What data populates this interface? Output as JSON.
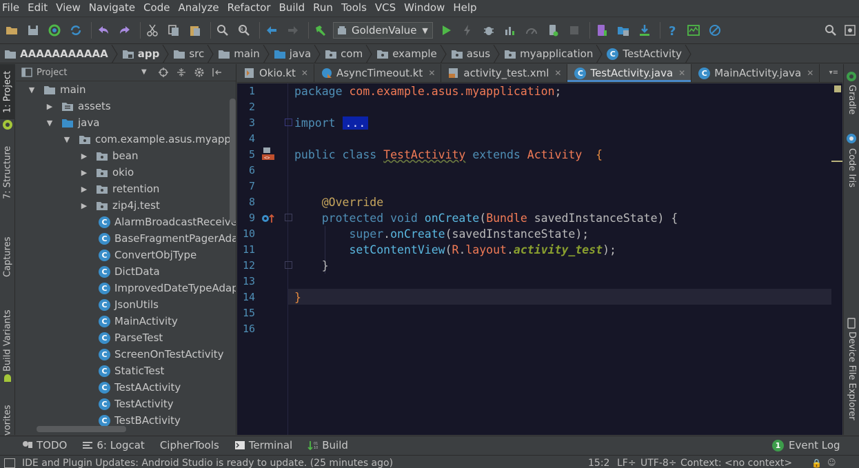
{
  "menu": [
    "File",
    "Edit",
    "View",
    "Navigate",
    "Code",
    "Analyze",
    "Refactor",
    "Build",
    "Run",
    "Tools",
    "VCS",
    "Window",
    "Help"
  ],
  "toolbar": {
    "run_config": "GoldenValue"
  },
  "breadcrumb": [
    "AAAAAAAAAAA",
    "app",
    "src",
    "main",
    "java",
    "com",
    "example",
    "asus",
    "myapplication",
    "TestActivity"
  ],
  "left_tabs": [
    "1: Project",
    "7: Structure",
    "Captures",
    "Build Variants",
    "vorites"
  ],
  "project_panel": {
    "title": "Project",
    "tree": [
      {
        "label": "main",
        "depth": 1,
        "state": "expanded",
        "kind": "folder"
      },
      {
        "label": "assets",
        "depth": 2,
        "state": "collapsed",
        "kind": "folder"
      },
      {
        "label": "java",
        "depth": 2,
        "state": "expanded",
        "kind": "folder-blue"
      },
      {
        "label": "com.example.asus.myapplicati",
        "depth": 3,
        "state": "expanded",
        "kind": "package"
      },
      {
        "label": "bean",
        "depth": 4,
        "state": "collapsed",
        "kind": "package"
      },
      {
        "label": "okio",
        "depth": 4,
        "state": "collapsed",
        "kind": "package"
      },
      {
        "label": "retention",
        "depth": 4,
        "state": "collapsed",
        "kind": "package"
      },
      {
        "label": "zip4j.test",
        "depth": 4,
        "state": "collapsed",
        "kind": "package"
      },
      {
        "label": "AlarmBroadcastReceiver",
        "depth": 4,
        "state": "leaf",
        "kind": "class"
      },
      {
        "label": "BaseFragmentPagerAdapte",
        "depth": 4,
        "state": "leaf",
        "kind": "class"
      },
      {
        "label": "ConvertObjType",
        "depth": 4,
        "state": "leaf",
        "kind": "class"
      },
      {
        "label": "DictData",
        "depth": 4,
        "state": "leaf",
        "kind": "class"
      },
      {
        "label": "ImprovedDateTypeAdapte",
        "depth": 4,
        "state": "leaf",
        "kind": "class"
      },
      {
        "label": "JsonUtils",
        "depth": 4,
        "state": "leaf",
        "kind": "class"
      },
      {
        "label": "MainActivity",
        "depth": 4,
        "state": "leaf",
        "kind": "class"
      },
      {
        "label": "ParseTest",
        "depth": 4,
        "state": "leaf",
        "kind": "class"
      },
      {
        "label": "ScreenOnTestActivity",
        "depth": 4,
        "state": "leaf",
        "kind": "class"
      },
      {
        "label": "StaticTest",
        "depth": 4,
        "state": "leaf",
        "kind": "class"
      },
      {
        "label": "TestAActivity",
        "depth": 4,
        "state": "leaf",
        "kind": "class"
      },
      {
        "label": "TestActivity",
        "depth": 4,
        "state": "leaf",
        "kind": "class"
      },
      {
        "label": "TestBActivity",
        "depth": 4,
        "state": "leaf",
        "kind": "class"
      }
    ]
  },
  "editor_tabs": [
    {
      "label": "Okio.kt",
      "active": false,
      "icon": "kotlin-file-icon"
    },
    {
      "label": "AsyncTimeout.kt",
      "active": false,
      "icon": "kotlin-class-icon"
    },
    {
      "label": "activity_test.xml",
      "active": false,
      "icon": "xml-file-icon"
    },
    {
      "label": "TestActivity.java",
      "active": true,
      "icon": "java-class-icon"
    },
    {
      "label": "MainActivity.java",
      "active": false,
      "icon": "java-class-icon"
    }
  ],
  "code": {
    "line_numbers": [
      "1",
      "2",
      "3",
      "4",
      "5",
      "6",
      "7",
      "8",
      "9",
      "10",
      "11",
      "12",
      "13",
      "14",
      "15",
      "16"
    ],
    "l1_kw": "package",
    "l1_pkg": "com.example.asus.myapplication",
    "l1_end": ";",
    "l3_kw": "import",
    "l3_fold": "...",
    "l6_kw1": "public class",
    "l6_cls": "TestActivity",
    "l6_kw2": "extends",
    "l6_sup": "Activity",
    "l6_brace": "{",
    "l9_ann": "@Override",
    "l10_kw": "protected void",
    "l10_fn": "onCreate",
    "l10_open": "(",
    "l10_type": "Bundle",
    "l10_param": " savedInstanceState) {",
    "l11_kw": "super",
    "l11_dot": ".",
    "l11_fn": "onCreate",
    "l11_rest": "(savedInstanceState);",
    "l12_fn": "setContentView",
    "l12_open": "(",
    "l12_r": "R",
    "l12_dot1": ".",
    "l12_layout": "layout",
    "l12_dot2": ".",
    "l12_field": "activity_test",
    "l12_end": ");",
    "l13_brace": "}",
    "l15_brace": "}"
  },
  "right_tabs": [
    "Gradle",
    "Code Iris",
    "Device File Explorer"
  ],
  "bottom_tabs": [
    {
      "label": "TODO",
      "icon": "todo-icon"
    },
    {
      "label": "6: Logcat",
      "icon": "logcat-icon"
    },
    {
      "label": "CipherTools",
      "icon": ""
    },
    {
      "label": "Terminal",
      "icon": "terminal-icon"
    },
    {
      "label": "Build",
      "icon": "build-icon"
    }
  ],
  "event_log": {
    "label": "Event Log",
    "count": "1"
  },
  "status": {
    "message": "IDE and Plugin Updates: Android Studio is ready to update. (25 minutes ago)",
    "position": "15:2",
    "line_sep": "LF÷",
    "encoding": "UTF-8÷",
    "context": "Context: <no context>"
  },
  "colors": {
    "editor_bg": "#161627",
    "keyword": "#4f8fb6",
    "accent": "#4a88c7"
  }
}
